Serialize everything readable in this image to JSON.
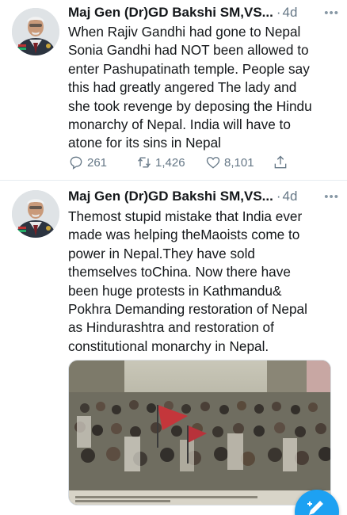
{
  "tweets": [
    {
      "author": "Maj Gen (Dr)GD Bakshi SM,VS...",
      "separator": "·",
      "time": "4d",
      "text": "When Rajiv Gandhi had gone to Nepal\nSonia Gandhi had NOT been allowed to\nenter Pashupatinath temple. People say\nthis had greatly angered The lady and\nshe took revenge by deposing the Hindu\nmonarchy of Nepal. India will have to\natone for its sins in Nepal",
      "replies": "261",
      "retweets": "1,426",
      "likes": "8,101"
    },
    {
      "author": "Maj Gen (Dr)GD Bakshi SM,VS...",
      "separator": "·",
      "time": "4d",
      "text": "Themost stupid mistake that India ever\nmade was helping theMaoists come to\npower in Nepal.They have sold\nthemselves toChina. Now there have\nbeen huge protests in Kathmandu&\nPokhra Demanding restoration of Nepal\nas  Hindurashtra and restoration of\nconstitutional monarchy in Nepal."
    }
  ],
  "icons": {
    "more": "more-icon",
    "reply": "reply-icon",
    "retweet": "retweet-icon",
    "like": "heart-icon",
    "share": "share-icon",
    "compose": "compose-tweet-icon"
  },
  "colors": {
    "text": "#14171a",
    "secondary": "#657786",
    "accent": "#1da1f2",
    "divider": "#e6ecf0"
  }
}
